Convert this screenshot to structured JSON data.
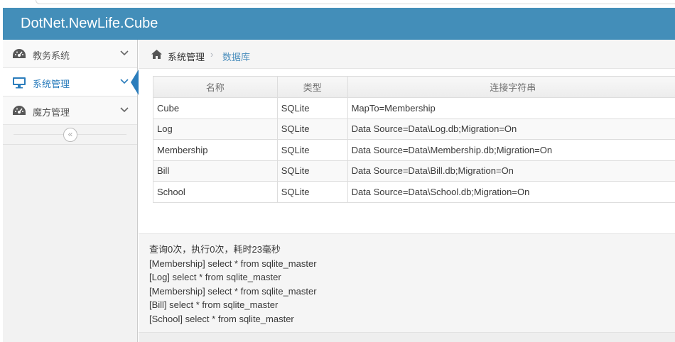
{
  "app": {
    "brand": "DotNet.NewLife.Cube"
  },
  "sidebar": {
    "items": [
      {
        "label": "教务系统",
        "icon": "dashboard-icon",
        "active": false
      },
      {
        "label": "系统管理",
        "icon": "desktop-icon",
        "active": true
      },
      {
        "label": "魔方管理",
        "icon": "dashboard-icon",
        "active": false
      }
    ],
    "collapse_label": "«"
  },
  "breadcrumb": {
    "home_icon": "home-icon",
    "level1": "系统管理",
    "separator": "›",
    "level2": "数据库"
  },
  "table": {
    "headers": [
      "名称",
      "类型",
      "连接字符串"
    ],
    "rows": [
      [
        "Cube",
        "SQLite",
        "MapTo=Membership"
      ],
      [
        "Log",
        "SQLite",
        "Data Source=Data\\Log.db;Migration=On"
      ],
      [
        "Membership",
        "SQLite",
        "Data Source=Data\\Membership.db;Migration=On"
      ],
      [
        "Bill",
        "SQLite",
        "Data Source=Data\\Bill.db;Migration=On"
      ],
      [
        "School",
        "SQLite",
        "Data Source=Data\\School.db;Migration=On"
      ]
    ]
  },
  "log": {
    "lines": [
      "查询0次，执行0次，耗时23毫秒",
      "[Membership] select * from sqlite_master",
      "[Log] select * from sqlite_master",
      "[Membership] select * from sqlite_master",
      "[Bill] select * from sqlite_master",
      "[School] select * from sqlite_master"
    ]
  },
  "colors": {
    "navbar": "#438eb9",
    "active": "#2b7dbc",
    "link": "#4c8fbd"
  }
}
